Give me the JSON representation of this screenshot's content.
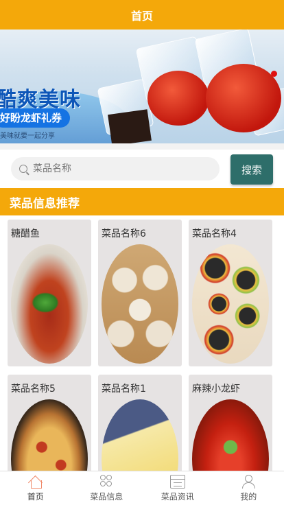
{
  "header": {
    "title": "首页"
  },
  "banner": {
    "title": "酷爽美味",
    "subtitle": "好盼龙虾礼券",
    "tagline": "美味就要一起分享"
  },
  "search": {
    "placeholder": "菜品名称",
    "button_label": "搜索"
  },
  "section": {
    "title": "菜品信息推荐"
  },
  "dishes": [
    {
      "name": "糖醋鱼",
      "image": "sweet-sour-fish"
    },
    {
      "name": "菜品名称6",
      "image": "steamed-dumplings"
    },
    {
      "name": "菜品名称4",
      "image": "sushi-rolls"
    },
    {
      "name": "菜品名称5",
      "image": "pizza"
    },
    {
      "name": "菜品名称1",
      "image": "dessert-cake"
    },
    {
      "name": "麻辣小龙虾",
      "image": "spicy-crayfish"
    }
  ],
  "tabbar": {
    "items": [
      {
        "label": "首页",
        "icon": "home-icon",
        "active": true
      },
      {
        "label": "菜品信息",
        "icon": "grid-icon",
        "active": false
      },
      {
        "label": "菜品资讯",
        "icon": "news-icon",
        "active": false
      },
      {
        "label": "我的",
        "icon": "user-icon",
        "active": false
      }
    ]
  },
  "colors": {
    "primary": "#f4a80a",
    "button": "#2e6e6a",
    "active_tab_icon": "#f08a6a"
  }
}
